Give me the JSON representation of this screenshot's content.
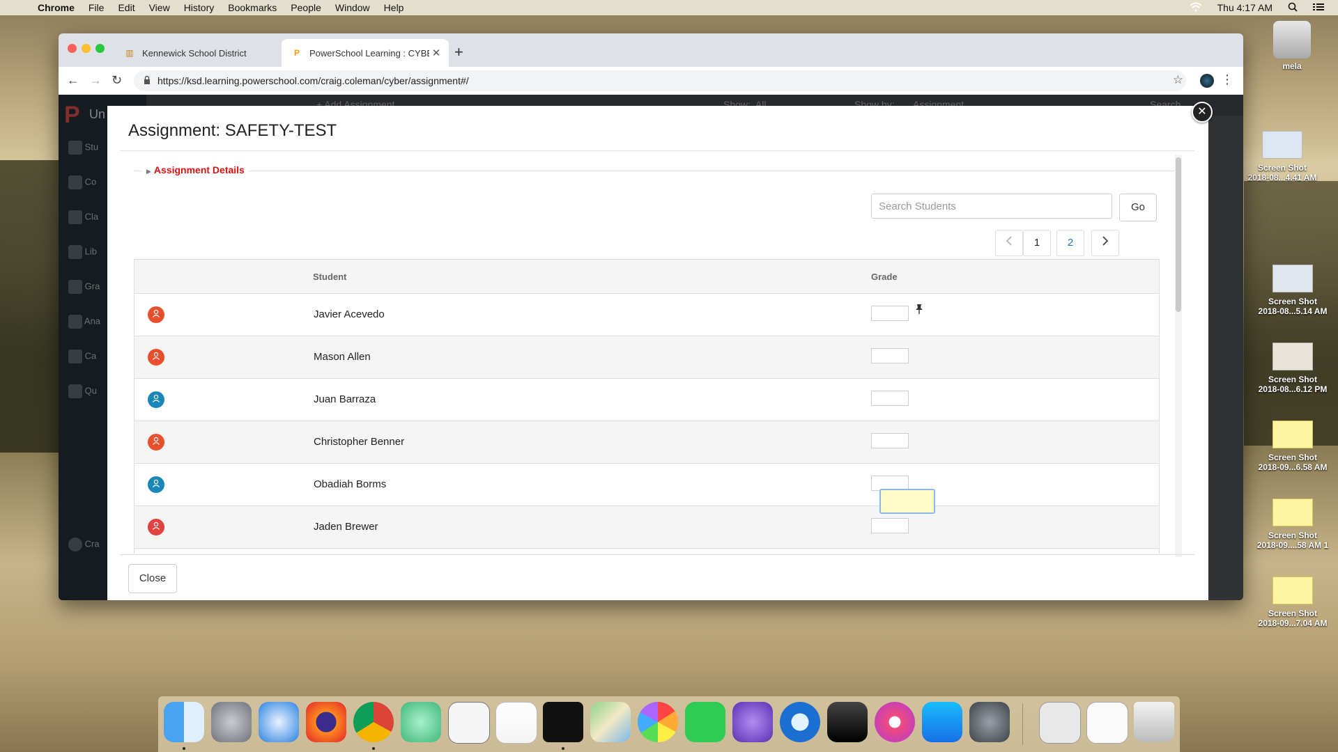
{
  "menubar": {
    "app": "Chrome",
    "items": [
      "File",
      "Edit",
      "View",
      "History",
      "Bookmarks",
      "People",
      "Window",
      "Help"
    ],
    "clock": "Thu 4:17 AM"
  },
  "desktop": {
    "drive_label": "mela",
    "files": [
      {
        "line1": "Screen Shot",
        "line2": "2018-08...4.41 AM"
      },
      {
        "line1": "Screen Shot",
        "line2": "2018-08...5.14 AM"
      },
      {
        "line1": "Screen Shot",
        "line2": "2018-08...6.12 PM"
      },
      {
        "line1": "Screen Shot",
        "line2": "2018-09...6.58 AM"
      },
      {
        "line1": "Screen Shot",
        "line2": "2018-09....58 AM 1"
      },
      {
        "line1": "Screen Shot",
        "line2": "2018-09...7.04 AM"
      }
    ]
  },
  "browser": {
    "tabs": [
      {
        "title": "Kennewick School District",
        "active": false
      },
      {
        "title": "PowerSchool Learning : CYBER",
        "active": true
      }
    ],
    "url": "https://ksd.learning.powerschool.com/craig.coleman/cyber/assignment#/"
  },
  "app_bg": {
    "brand": "Un",
    "add_assignment": "Add Assignment",
    "show_label": "Show:",
    "show_value": "All",
    "show_by_label": "Show by:",
    "show_by_value": "Assignment",
    "search": "Search",
    "sidebar_initials": [
      "Stu",
      "Co",
      "Cla",
      "Lib",
      "Gra",
      "Ana",
      "Ca",
      "Qu"
    ],
    "user": "Cra"
  },
  "modal": {
    "title": "Assignment: SAFETY-TEST",
    "details_label": "Assignment Details",
    "search_placeholder": "Search Students",
    "go_label": "Go",
    "pages": [
      "1",
      "2"
    ],
    "columns": {
      "student": "Student",
      "grade": "Grade"
    },
    "students": [
      {
        "name": "Javier Acevedo",
        "color": "#e8502d"
      },
      {
        "name": "Mason Allen",
        "color": "#e8502d"
      },
      {
        "name": "Juan Barraza",
        "color": "#1b87b8"
      },
      {
        "name": "Christopher Benner",
        "color": "#e8502d"
      },
      {
        "name": "Obadiah Borms",
        "color": "#1b87b8"
      },
      {
        "name": "Jaden Brewer",
        "color": "#e2413f"
      }
    ],
    "close_label": "Close"
  },
  "dock_apps": [
    "Finder",
    "Launchpad",
    "Safari",
    "Firefox",
    "Chrome",
    "Atom",
    "TextEdit",
    "Notes",
    "Terminal",
    "Maps",
    "Photos",
    "FaceTime",
    "iMovie",
    "QuickTime",
    "Inkscape",
    "iTunes",
    "App Store",
    "System Preferences",
    "Downloads",
    "Documents",
    "Trash"
  ],
  "colors": {
    "accent_red": "#d11111",
    "page_link": "#1a73b8",
    "highlight_input": "#fffbc9"
  }
}
